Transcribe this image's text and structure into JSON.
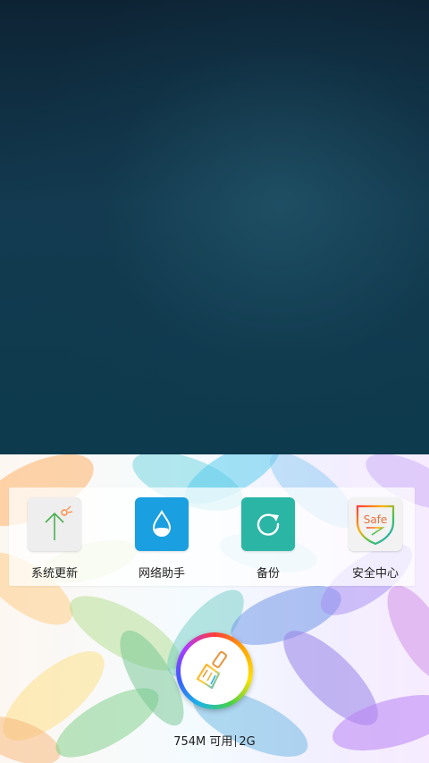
{
  "shortcuts": [
    {
      "label": "系统更新",
      "icon": "system-update-icon",
      "icon_color": "#eeeeee"
    },
    {
      "label": "网络助手",
      "icon": "network-assistant-icon",
      "icon_color": "#1a9fe0"
    },
    {
      "label": "备份",
      "icon": "backup-icon",
      "icon_color": "#2bb5a5"
    },
    {
      "label": "安全中心",
      "icon": "security-center-icon",
      "icon_color": "#f2f2f2"
    }
  ],
  "security_icon_text": "Safe",
  "cleaner": {
    "icon": "broom-icon"
  },
  "memory": {
    "available": "754M 可用",
    "total": "2G"
  }
}
